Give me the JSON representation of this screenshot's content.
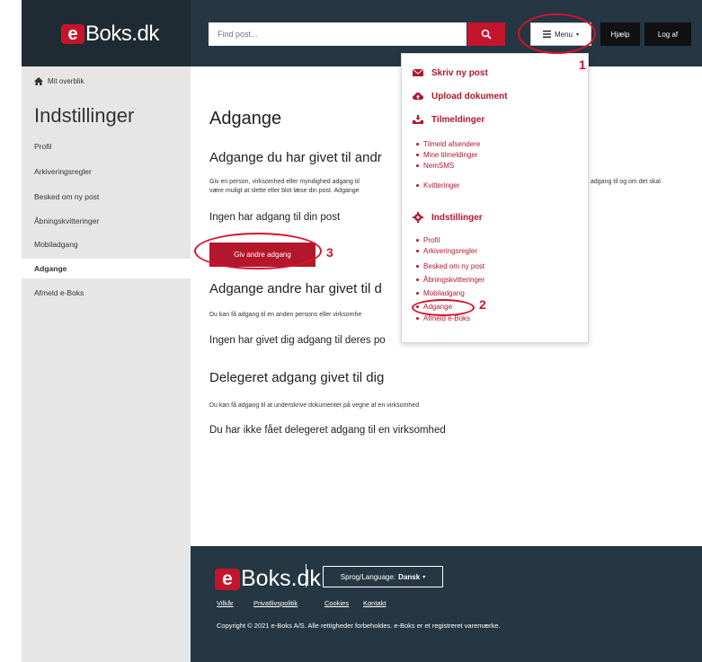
{
  "header": {
    "logo_e": "e",
    "logo_text": "Boks.dk",
    "search_placeholder": "Find post...",
    "menu_label": "Menu",
    "help_label": "Hjælp",
    "logout_label": "Log af"
  },
  "sidebar": {
    "overview": "Mit overblik",
    "title": "Indstillinger",
    "items": [
      {
        "label": "Profil"
      },
      {
        "label": "Arkiveringsregler"
      },
      {
        "label": "Besked om ny post"
      },
      {
        "label": "Åbningskvitteringer"
      },
      {
        "label": "Mobiladgang"
      },
      {
        "label": "Adgange"
      },
      {
        "label": "Afmeld e-Boks"
      }
    ],
    "active": "Adgange"
  },
  "main": {
    "title": "Adgange",
    "section1_title": "Adgange du har givet til andr",
    "section1_desc_line1": "Giv en person, virksomhed eller myndighed adgang til",
    "section1_desc_line1_right": "adgang til og om det skal",
    "section1_desc_line2": "være muligt at slette eller blot læse din post. Adgange",
    "section1_empty": "Ingen har adgang til din post",
    "grant_button": "Giv andre adgang",
    "section2_title": "Adgange andre har givet til d",
    "section2_desc": "Du kan få adgang til en anden persons eller virksomhe",
    "section2_empty": "Ingen har givet dig adgang til deres po",
    "section3_title": "Delegeret adgang givet til dig",
    "section3_desc": "Du kan få adgang til at underskrive dokumenter på vegne af en virksomhed",
    "section3_empty": "Du har ikke fået delegeret adgang til en virksomhed"
  },
  "dropdown": {
    "write_new": "Skriv ny post",
    "upload": "Upload dokument",
    "subscriptions": "Tilmeldinger",
    "subscription_items": [
      "Tilmeld afsendere",
      "Mine tilmeldinger",
      "NemSMS",
      "Kvitteringer"
    ],
    "settings": "Indstillinger",
    "settings_items": [
      "Profil",
      "Arkiveringsregler",
      "Besked om ny post",
      "Åbningskvitteringer",
      "Mobiladgang",
      "Adgange",
      "Afmeld e-Boks"
    ]
  },
  "footer": {
    "logo_e": "e",
    "logo_text": "Boks.dk",
    "language_label": "Sprog/Language:",
    "language_value": "Dansk",
    "links": [
      "Vilkår",
      "Privatlivspolitik",
      "Cookies",
      "Kontakt"
    ],
    "copyright": "Copyright © 2021 e-Boks A/S. Alle rettigheder forbeholdes. e-Boks er et registreret varemærke."
  },
  "annotations": [
    "1",
    "2",
    "3"
  ],
  "colors": {
    "brand_red": "#c4152d",
    "header_dark": "#1f2b33",
    "header_blue": "#243743",
    "annotation_red": "#d8112c"
  }
}
